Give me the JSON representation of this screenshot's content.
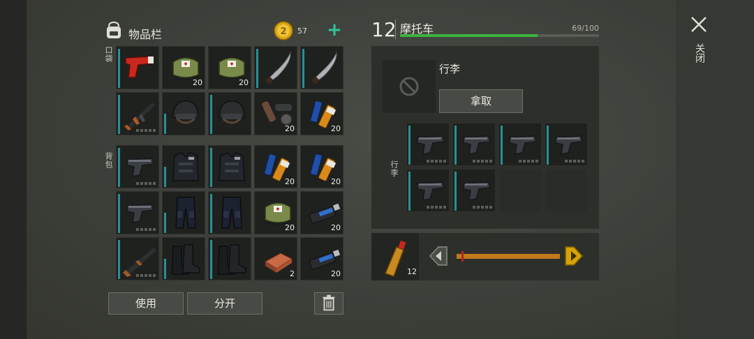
{
  "inventory": {
    "title": "物品栏",
    "coins": "57",
    "pockets_label": "口袋",
    "backpack_label": "背包",
    "use_label": "使用",
    "split_label": "分开"
  },
  "items": {
    "flare": {
      "qty": ""
    },
    "medbag1": {
      "qty": "20"
    },
    "medbag2": {
      "qty": "20"
    },
    "machete1": {
      "qty": ""
    },
    "machete2": {
      "qty": ""
    },
    "rifle": {
      "qty": ""
    },
    "helmet1": {
      "qty": ""
    },
    "helmet2": {
      "qty": ""
    },
    "parts": {
      "qty": "20"
    },
    "batteries1": {
      "qty": "20"
    },
    "pistol1": {
      "qty": ""
    },
    "vest1": {
      "qty": ""
    },
    "vest2": {
      "qty": ""
    },
    "batteries2": {
      "qty": "20"
    },
    "batteries3": {
      "qty": "20"
    },
    "pistol2": {
      "qty": ""
    },
    "pants1": {
      "qty": ""
    },
    "pants2": {
      "qty": ""
    },
    "medbag3": {
      "qty": "20"
    },
    "usb1": {
      "qty": "20"
    },
    "shotgun": {
      "qty": ""
    },
    "boots1": {
      "qty": ""
    },
    "boots2": {
      "qty": ""
    },
    "copper": {
      "qty": "2"
    },
    "usb2": {
      "qty": "20"
    }
  },
  "vehicle": {
    "level": "12",
    "name": "摩托车",
    "capacity": "69/100",
    "capacity_fraction": 0.69,
    "trunk_title": "行李",
    "take_label": "拿取",
    "trunk_label": "行李",
    "fuel_qty": "12"
  },
  "close_label": "关闭",
  "colors": {
    "accent_teal": "#2a8f97",
    "add_green": "#2fc49c",
    "capacity_green": "#3db33d",
    "fuel_orange": "#c17a1c",
    "arrow_yellow": "#d6a300"
  }
}
